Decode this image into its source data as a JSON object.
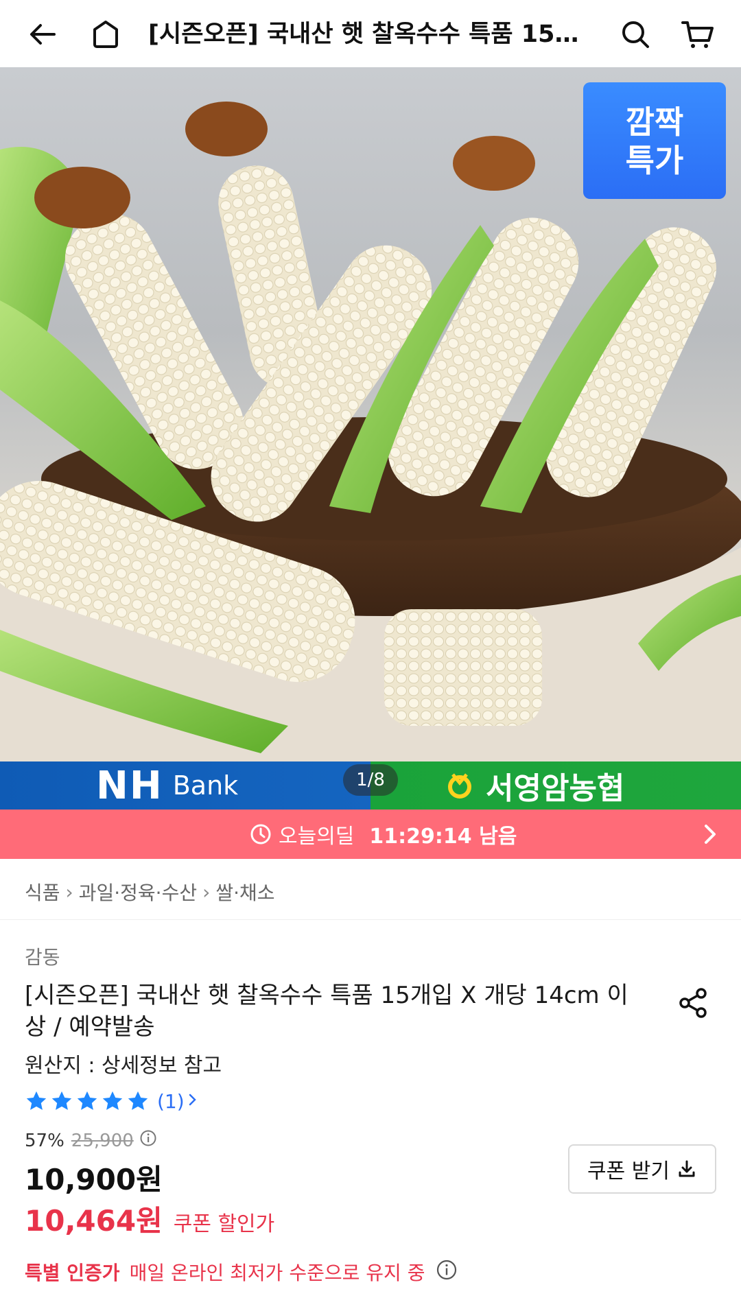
{
  "header": {
    "title": "[시즌오픈] 국내산 햇 찰옥수수 특품 15개입 X 개당 14cm 이상 / 예약발송",
    "icons": [
      "back-arrow-icon",
      "home-icon",
      "search-icon",
      "cart-icon"
    ]
  },
  "hero": {
    "badge_line1": "깜짝",
    "badge_line2": "특가",
    "image_description": "white waxy corn in a wicker basket"
  },
  "banner": {
    "nh": "NH",
    "bank": "Bank",
    "pager": "1/8",
    "partner": "서영암농협"
  },
  "deal": {
    "label": "오늘의딜",
    "time_left": "11:29:14 남음"
  },
  "breadcrumb": [
    "식품",
    "과일·정육·수산",
    "쌀·채소"
  ],
  "product": {
    "brand": "감동",
    "title": "[시즌오픈] 국내산 햇 찰옥수수 특품 15개입 X 개당 14cm 이상 / 예약발송",
    "origin": "원산지 : 상세정보 참고",
    "rating": {
      "stars": 5,
      "count_text": "(1)"
    },
    "discount_rate": "57%",
    "original_price": "25,900",
    "price": "10,900원",
    "coupon_price": "10,464원",
    "coupon_price_label": "쿠폰 할인가",
    "coupon_button": "쿠폰 받기",
    "special_label": "특별 인증가",
    "special_desc": "매일 온라인 최저가 수준으로 유지 중"
  },
  "colors": {
    "accent_red": "#e8334a",
    "deal_bar": "#ff6b78",
    "badge_blue": "#2b6ef5",
    "star_blue": "#1e88ff"
  }
}
